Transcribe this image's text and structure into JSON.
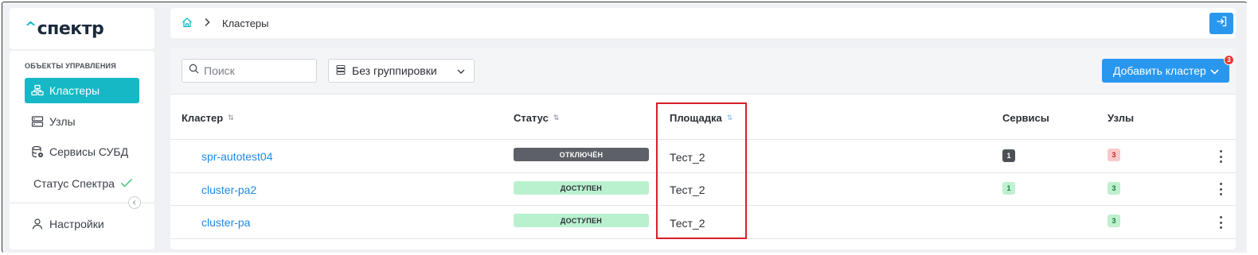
{
  "brand": {
    "caret": "^",
    "name": "спектр"
  },
  "sidebar": {
    "section_title": "ОБЪЕКТЫ УПРАВЛЕНИЯ",
    "items": [
      {
        "label": "Кластеры",
        "icon": "cluster-icon",
        "active": true
      },
      {
        "label": "Узлы",
        "icon": "server-icon",
        "active": false
      },
      {
        "label": "Сервисы СУБД",
        "icon": "database-icon",
        "active": false
      }
    ],
    "status_label": "Статус Спектра",
    "settings_label": "Настройки"
  },
  "breadcrumb": {
    "current": "Кластеры"
  },
  "toolbar": {
    "search_placeholder": "Поиск",
    "grouping_value": "Без группировки",
    "add_button_label": "Добавить кластер",
    "notification_count": "3"
  },
  "table": {
    "columns": {
      "cluster": "Кластер",
      "status": "Статус",
      "site": "Площадка",
      "services": "Сервисы",
      "nodes": "Узлы"
    },
    "rows": [
      {
        "cluster": "spr-autotest04",
        "status": "ОТКЛЮЧЁН",
        "site": "Тест_2",
        "services": "1",
        "nodes": "3"
      },
      {
        "cluster": "cluster-pa2",
        "status": "ДОСТУПЕН",
        "site": "Тест_2",
        "services": "1",
        "nodes": "3"
      },
      {
        "cluster": "cluster-pa",
        "status": "ДОСТУПЕН",
        "site": "Тест_2",
        "services": "",
        "nodes": "3"
      }
    ]
  },
  "colors": {
    "accent": "#16b8c6",
    "primary_button": "#2a97ee",
    "link": "#1e88e5",
    "highlight_box": "#d81e2a"
  }
}
